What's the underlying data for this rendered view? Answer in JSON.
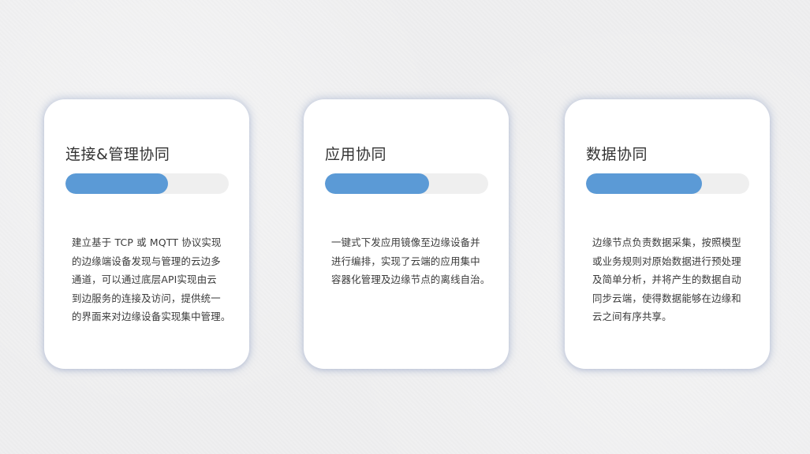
{
  "colors": {
    "accent": "#5b9ad6",
    "track": "#efefef",
    "card": "#ffffff",
    "text": "#333333"
  },
  "cards": [
    {
      "title": "连接&管理协同",
      "progress": 0.63,
      "lines": [
        "建立基于 TCP 或 MQTT 协议实现",
        "的边缘端设备发现与管理的云边多",
        "通道，可以通过底层API实现由云",
        "到边服务的连接及访问，提供统一",
        "的界面来对边缘设备实现集中管理。"
      ]
    },
    {
      "title": "应用协同",
      "progress": 0.64,
      "lines": [
        "一键式下发应用镜像至边缘设备并",
        "进行编排，实现了云端的应用集中",
        "容器化管理及边缘节点的离线自治。"
      ]
    },
    {
      "title": "数据协同",
      "progress": 0.71,
      "lines": [
        "边缘节点负责数据采集，按照模型",
        "或业务规则对原始数据进行预处理",
        "及简单分析，并将产生的数据自动",
        "同步云端，使得数据能够在边缘和",
        "云之间有序共享。"
      ]
    }
  ]
}
